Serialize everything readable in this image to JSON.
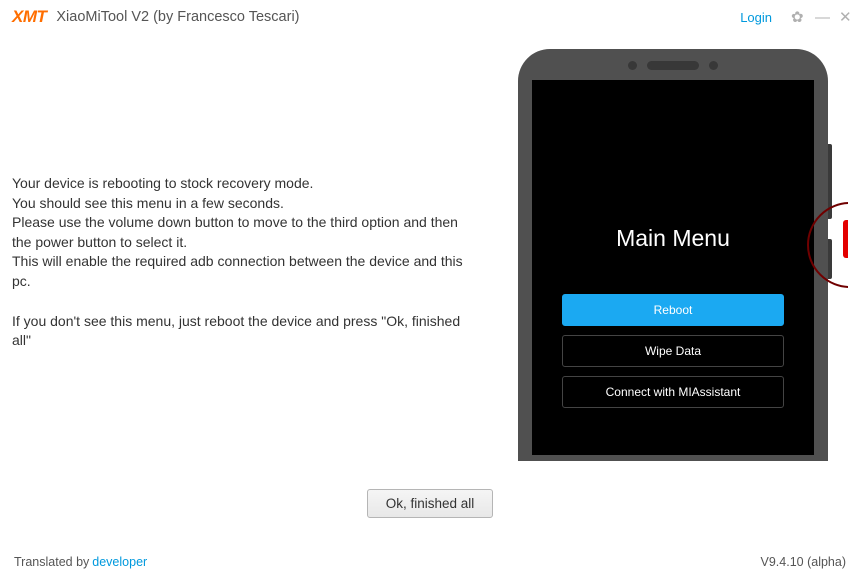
{
  "header": {
    "logo": "XMT",
    "title": "XiaoMiTool V2 (by Francesco Tescari)",
    "login": "Login"
  },
  "instructions": {
    "line1": "Your device is rebooting to stock recovery mode.",
    "line2": "You should see this menu in a few seconds.",
    "line3": "Please use the volume down button to move to the third option and then the power button to select it.",
    "line4": "This will enable the required adb connection between the device and this pc.",
    "line5": "If you don't see this menu, just reboot the device and press \"Ok, finished all\""
  },
  "phone": {
    "menuTitle": "Main Menu",
    "buttons": {
      "reboot": "Reboot",
      "wipe": "Wipe Data",
      "connect": "Connect with MIAssistant"
    }
  },
  "actions": {
    "ok": "Ok, finished all"
  },
  "footer": {
    "translatedBy": "Translated by",
    "developer": "developer",
    "version": "V9.4.10 (alpha)"
  }
}
